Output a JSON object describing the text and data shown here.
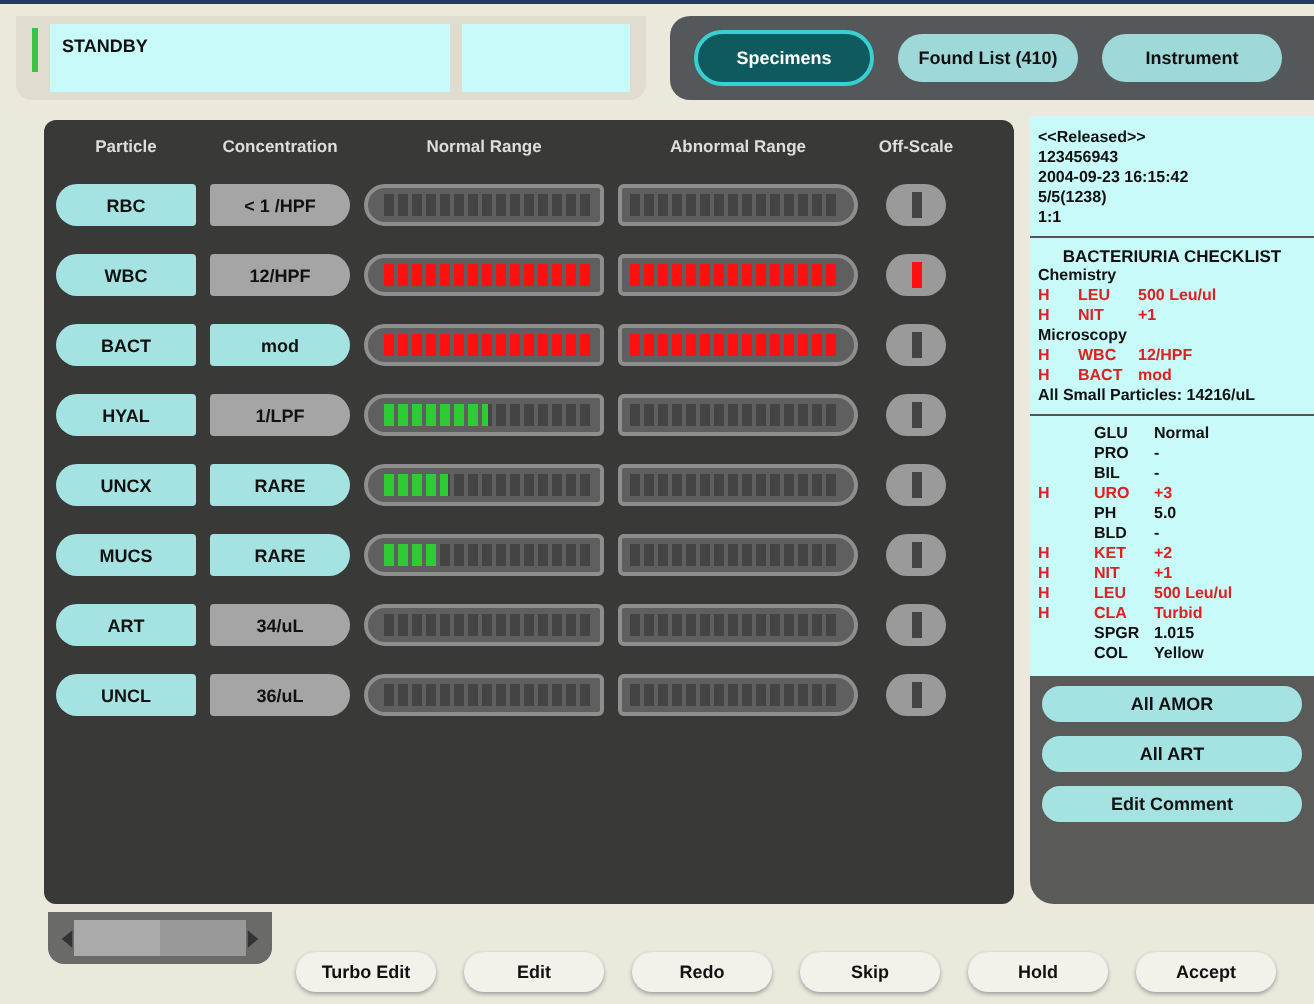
{
  "status": {
    "text": "STANDBY"
  },
  "tabs": [
    {
      "label": "Specimens",
      "selected": true
    },
    {
      "label": "Found List (410)",
      "selected": false
    },
    {
      "label": "Instrument",
      "selected": false
    }
  ],
  "table": {
    "columns": [
      "Particle",
      "Concentration",
      "Normal Range",
      "Abnormal Range",
      "Off-Scale"
    ],
    "rows": [
      {
        "particle": "RBC",
        "concentration": "< 1 /HPF",
        "highlighted": false,
        "normal_range": {
          "level": 0
        },
        "abnormal_range": {
          "level": 0
        },
        "off_scale": false
      },
      {
        "particle": "WBC",
        "concentration": "12/HPF",
        "highlighted": false,
        "normal_range": {
          "level": 1
        },
        "abnormal_range": {
          "level": 1
        },
        "off_scale": true
      },
      {
        "particle": "BACT",
        "concentration": "mod",
        "highlighted": true,
        "normal_range": {
          "level": 1
        },
        "abnormal_range": {
          "level": 1
        },
        "off_scale": false
      },
      {
        "particle": "HYAL",
        "concentration": "1/LPF",
        "highlighted": false,
        "normal_range": {
          "level": 0.5
        },
        "abnormal_range": {
          "level": 0
        },
        "off_scale": false
      },
      {
        "particle": "UNCX",
        "concentration": "RARE",
        "highlighted": true,
        "normal_range": {
          "level": 0.31
        },
        "abnormal_range": {
          "level": 0
        },
        "off_scale": false
      },
      {
        "particle": "MUCS",
        "concentration": "RARE",
        "highlighted": true,
        "normal_range": {
          "level": 0.25
        },
        "abnormal_range": {
          "level": 0
        },
        "off_scale": false
      },
      {
        "particle": "ART",
        "concentration": "34/uL",
        "highlighted": false,
        "normal_range": {
          "level": 0
        },
        "abnormal_range": {
          "level": 0
        },
        "off_scale": false
      },
      {
        "particle": "UNCL",
        "concentration": "36/uL",
        "highlighted": false,
        "normal_range": {
          "level": 0
        },
        "abnormal_range": {
          "level": 0
        },
        "off_scale": false
      }
    ]
  },
  "report": {
    "header_lines": [
      "<<Released>>",
      "123456943",
      "2004-09-23 16:15:42",
      "5/5(1238)",
      "1:1"
    ],
    "checklist_title": "BACTERIURIA CHECKLIST",
    "groups": [
      {
        "title": "Chemistry",
        "results": [
          {
            "flag": "H",
            "name": "LEU",
            "value": "500 Leu/ul",
            "high": true
          },
          {
            "flag": "H",
            "name": "NIT",
            "value": "+1",
            "high": true
          }
        ]
      },
      {
        "title": "Microscopy",
        "results": [
          {
            "flag": "H",
            "name": "WBC",
            "value": "12/HPF",
            "high": true
          },
          {
            "flag": "H",
            "name": "BACT",
            "value": "mod",
            "high": true
          }
        ]
      }
    ],
    "summary": "All Small Particles: 14216/uL",
    "dipstick": [
      {
        "name": "GLU",
        "value": "Normal",
        "high": false
      },
      {
        "name": "PRO",
        "value": "-",
        "high": false
      },
      {
        "name": "BIL",
        "value": "-",
        "high": false
      },
      {
        "flag": "H",
        "name": "URO",
        "value": "+3",
        "high": true
      },
      {
        "name": "PH",
        "value": "5.0",
        "high": false
      },
      {
        "name": "BLD",
        "value": "-",
        "high": false
      },
      {
        "flag": "H",
        "name": "KET",
        "value": "+2",
        "high": true
      },
      {
        "flag": "H",
        "name": "NIT",
        "value": "+1",
        "high": true
      },
      {
        "flag": "H",
        "name": "LEU",
        "value": "500 Leu/ul",
        "high": true
      },
      {
        "flag": "H",
        "name": "CLA",
        "value": "Turbid",
        "high": true
      },
      {
        "name": "SPGR",
        "value": "1.015",
        "high": false
      },
      {
        "name": "COL",
        "value": "Yellow",
        "high": false
      }
    ]
  },
  "side_buttons": [
    "All AMOR",
    "All ART",
    "Edit Comment"
  ],
  "bottom_buttons": [
    "Turbo Edit",
    "Edit",
    "Redo",
    "Skip",
    "Hold",
    "Accept"
  ]
}
